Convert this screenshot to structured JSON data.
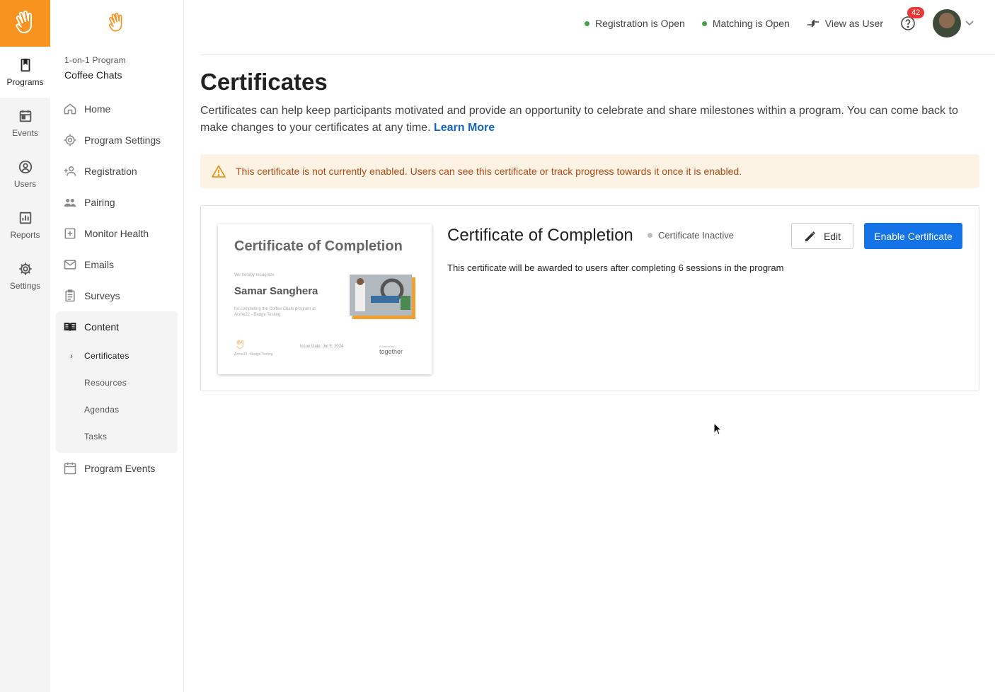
{
  "rail": {
    "items": [
      {
        "label": "Programs",
        "icon": "book-icon"
      },
      {
        "label": "Events",
        "icon": "calendar-icon"
      },
      {
        "label": "Users",
        "icon": "user-circle-icon"
      },
      {
        "label": "Reports",
        "icon": "bar-chart-icon"
      },
      {
        "label": "Settings",
        "icon": "gear-icon"
      }
    ]
  },
  "program": {
    "type": "1-on-1 Program",
    "name": "Coffee Chats"
  },
  "nav": {
    "home": "Home",
    "program_settings": "Program Settings",
    "registration": "Registration",
    "pairing": "Pairing",
    "monitor_health": "Monitor Health",
    "emails": "Emails",
    "surveys": "Surveys",
    "content": "Content",
    "certificates": "Certificates",
    "resources": "Resources",
    "agendas": "Agendas",
    "tasks": "Tasks",
    "program_events": "Program Events"
  },
  "topbar": {
    "registration_status": "Registration is Open",
    "matching_status": "Matching is Open",
    "view_as_user": "View as User",
    "notification_count": "42"
  },
  "page": {
    "title": "Certificates",
    "description": "Certificates can help keep participants motivated and provide an opportunity to celebrate and share milestones within a program. You can come back to make changes to your certificates at any time.",
    "learn_more": "Learn More",
    "alert": "This certificate is not currently enabled. Users can see this certificate or track progress towards it once it is enabled."
  },
  "certificate": {
    "title": "Certificate of Completion",
    "status": "Certificate Inactive",
    "edit_label": "Edit",
    "enable_label": "Enable Certificate",
    "description": "This certificate will be awarded to users after completing 6 sessions in the program",
    "preview": {
      "title": "Certificate of Completion",
      "recognize": "We hereby recognize",
      "name": "Samar Sanghera",
      "line1": "for completing the Coffee Chats program at",
      "line2": "Acme22 - Badge Testing",
      "issue_date": "Issue Date: Jul 5, 2024",
      "org": "Acme22 - Badge Testing",
      "powered": "Powered by",
      "brand": "together"
    }
  },
  "colors": {
    "brand_orange": "#f7931e",
    "primary_blue": "#1473e6",
    "status_green": "#43a047",
    "alert_bg": "#fdf3e5",
    "alert_text": "#b04a12"
  }
}
